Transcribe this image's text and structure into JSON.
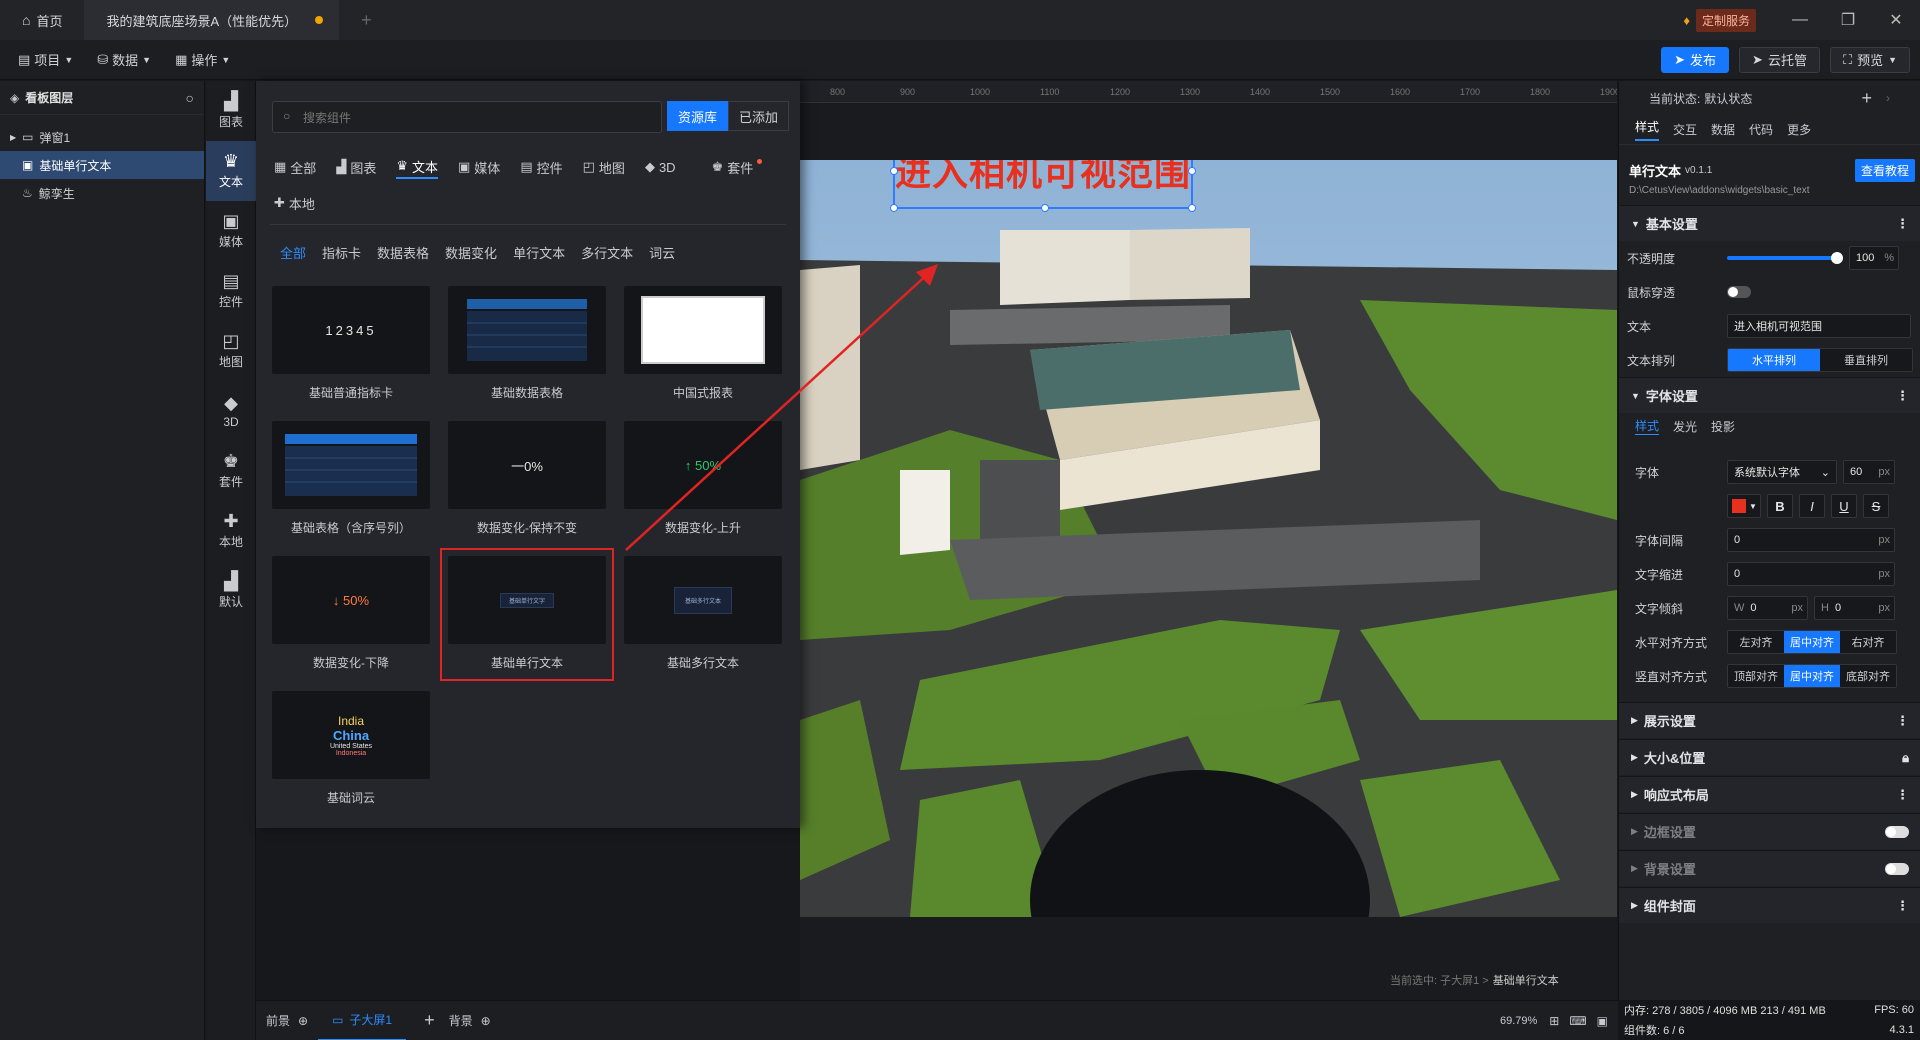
{
  "titlebar": {
    "home_tab": "首页",
    "doc_tab": "我的建筑底座场景A（性能优先）",
    "custom_service": "定制服务"
  },
  "menubar": {
    "project": "项目",
    "data": "数据",
    "operate": "操作",
    "publish": "发布",
    "cloud_host": "云托管",
    "preview": "预览"
  },
  "layers": {
    "title": "看板图层",
    "items": [
      {
        "label": "弹窗1"
      },
      {
        "label": "基础单行文本"
      },
      {
        "label": "鲸孪生"
      }
    ]
  },
  "iconcol": {
    "items": [
      {
        "label": "图表",
        "icon": "chart-icon"
      },
      {
        "label": "文本",
        "icon": "text-icon"
      },
      {
        "label": "媒体",
        "icon": "media-icon"
      },
      {
        "label": "控件",
        "icon": "control-icon"
      },
      {
        "label": "地图",
        "icon": "map-icon"
      },
      {
        "label": "3D",
        "icon": "cube-icon"
      },
      {
        "label": "套件",
        "icon": "suite-icon"
      },
      {
        "label": "本地",
        "icon": "puzzle-icon"
      },
      {
        "label": "默认",
        "icon": "default-chart-icon"
      }
    ]
  },
  "drawer": {
    "search_placeholder": "搜索组件",
    "resource_lib": "资源库",
    "added": "已添加",
    "categories": [
      "全部",
      "图表",
      "文本",
      "媒体",
      "控件",
      "地图",
      "3D",
      "套件"
    ],
    "local": "本地",
    "subcats": [
      "全部",
      "指标卡",
      "数据表格",
      "数据变化",
      "单行文本",
      "多行文本",
      "词云"
    ],
    "cards": [
      {
        "label": "基础普通指标卡",
        "preview": "12345"
      },
      {
        "label": "基础数据表格",
        "preview": ""
      },
      {
        "label": "中国式报表",
        "preview": ""
      },
      {
        "label": "基础表格（含序号列）",
        "preview": ""
      },
      {
        "label": "数据变化-保持不变",
        "preview": "一0%"
      },
      {
        "label": "数据变化-上升",
        "preview": "↑ 50%"
      },
      {
        "label": "数据变化-下降",
        "preview": "↓ 50%"
      },
      {
        "label": "基础单行文本",
        "preview": "基础单行文字"
      },
      {
        "label": "基础多行文本",
        "preview": "基础多行文本"
      },
      {
        "label": "基础词云",
        "preview": ""
      }
    ],
    "wordcloud": [
      "India",
      "China",
      "United States",
      "Indonesia"
    ]
  },
  "canvas": {
    "ruler_ticks": [
      "800",
      "900",
      "1000",
      "1100",
      "1200",
      "1300",
      "1400",
      "1500",
      "1600",
      "1700",
      "1800",
      "1900"
    ],
    "text_widget": "进入相机可视范围",
    "current_selection_prefix": "当前选中: 子大屏1 >",
    "current_selection": "基础单行文本"
  },
  "rightpanel": {
    "state_label": "当前状态:",
    "state_value": "默认状态",
    "tabs": [
      "样式",
      "交互",
      "数据",
      "代码",
      "更多"
    ],
    "widget_name": "单行文本",
    "widget_version": "v0.1.1",
    "widget_path": "D:\\CetusView\\addons\\widgets\\basic_text",
    "tutorial": "查看教程",
    "basic": "基本设置",
    "opacity_label": "不透明度",
    "opacity_value": "100",
    "opacity_unit": "%",
    "mouse_through": "鼠标穿透",
    "text_label": "文本",
    "text_value": "进入相机可视范围",
    "arrange_label": "文本排列",
    "arrange_h": "水平排列",
    "arrange_v": "垂直排列",
    "font_section": "字体设置",
    "font_tabs": [
      "样式",
      "发光",
      "投影"
    ],
    "font_label": "字体",
    "font_value": "系统默认字体",
    "font_size": "60",
    "px": "px",
    "letter_spacing_label": "字体间隔",
    "letter_spacing": "0",
    "indent_label": "文字缩进",
    "indent": "0",
    "skew_label": "文字倾斜",
    "skew_w_label": "W",
    "skew_w": "0",
    "skew_h_label": "H",
    "skew_h": "0",
    "halign_label": "水平对齐方式",
    "halign": [
      "左对齐",
      "居中对齐",
      "右对齐"
    ],
    "valign_label": "竖直对齐方式",
    "valign": [
      "顶部对齐",
      "居中对齐",
      "底部对齐"
    ],
    "sections": [
      "展示设置",
      "大小&位置",
      "响应式布局",
      "边框设置",
      "背景设置",
      "组件封面"
    ],
    "text_color": "#e8301e"
  },
  "bottombar": {
    "front": "前景",
    "sub_screen": "子大屏1",
    "background": "背景",
    "zoom": "69.79%"
  },
  "statusbar": {
    "memory": "内存: 278 / 3805 / 4096 MB 213 / 491 MB",
    "fps": "FPS: 60",
    "count": "组件数: 6 / 6",
    "version": "4.3.1"
  },
  "colors": {
    "accent": "#1677ff",
    "highlight_box": "#e02424",
    "arrow": "#e02424"
  }
}
